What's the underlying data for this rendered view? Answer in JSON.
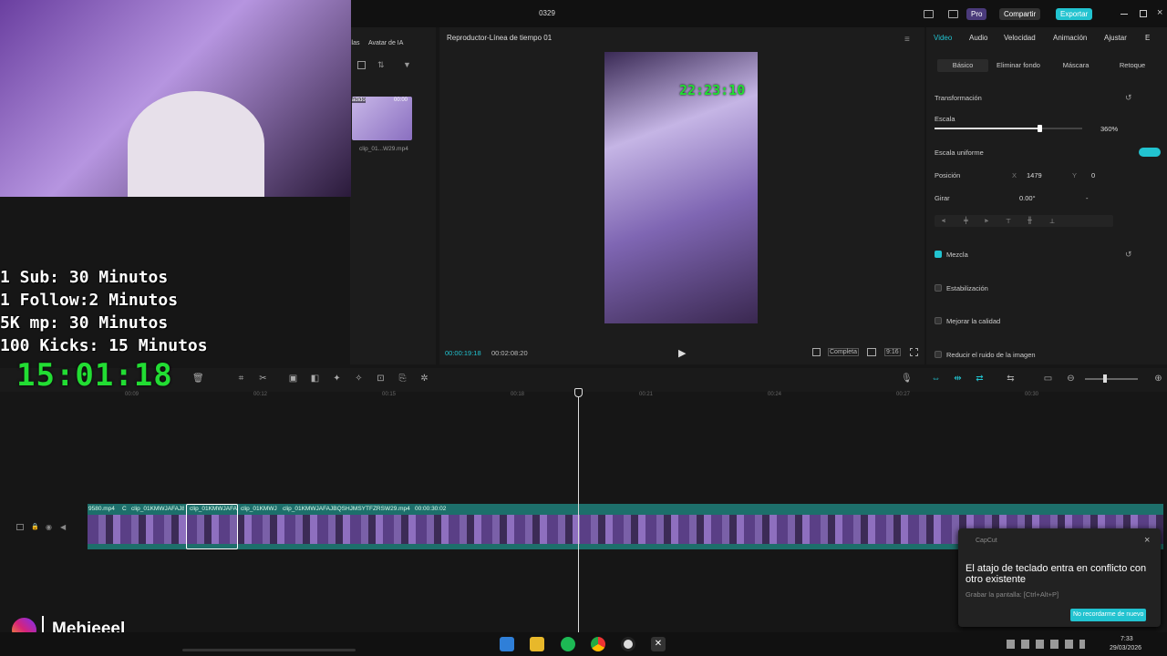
{
  "window": {
    "project_name": "0329",
    "pro_label": "Pro",
    "share_label": "Compartir",
    "export_label": "Exportar"
  },
  "media": {
    "tab_templates": "llas",
    "tab_ai_avatar": "Avatar de IA",
    "thumb_badge_left": "adido",
    "thumb_duration": "00:00",
    "thumb_name": "clip_01...W29.mp4"
  },
  "player": {
    "title": "Reproductor-Línea de tiempo 01",
    "preview_clock": "22:23:10",
    "current_time": "00:00:19:18",
    "total_time": "00:02:08:20",
    "quality_label": "Completa",
    "ratio_label": "9:16"
  },
  "props": {
    "tabs": [
      "Video",
      "Audio",
      "Velocidad",
      "Animación",
      "Ajustar",
      "E"
    ],
    "subtabs": [
      "Básico",
      "Eliminar fondo",
      "Máscara",
      "Retoque"
    ],
    "transform_label": "Transformación",
    "scale_label": "Escala",
    "scale_value": "360%",
    "uniform_scale_label": "Escala uniforme",
    "position_label": "Posición",
    "pos_x_label": "X",
    "pos_x": "1479",
    "pos_y_label": "Y",
    "pos_y": "0",
    "rotate_label": "Girar",
    "rotate_value": "0.00°",
    "rotate_extra": "-",
    "blend_label": "Mezcla",
    "stabilize_label": "Estabilización",
    "improve_label": "Mejorar la calidad",
    "denoise_label": "Reducir el ruido de la imagen",
    "accent_color": "#22c3d0"
  },
  "timeline": {
    "ruler": [
      "00:09",
      "00:12",
      "00:15",
      "00:18",
      "00:21",
      "00:24",
      "00:27",
      "00:30"
    ],
    "clip_labels": [
      "9580.mp4",
      "C",
      "clip_01KMWJAFAJ8",
      "clip_01KMWJAFA",
      "clip_01KMWJ",
      "clip_01KMWJAFAJBQSHJMSYTFZRSW29.mp4",
      "00:00:30:02"
    ]
  },
  "overlay": {
    "lines": [
      "1 Sub: 30 Minutos",
      "1 Follow:2 Minutos",
      "5K mp: 30 Minutos",
      "100 Kicks: 15 Minutos"
    ],
    "timer": "15:01:18",
    "handle": "Mehieeel"
  },
  "toast": {
    "app": "CapCut",
    "message": "El atajo de teclado entra en conflicto con otro existente",
    "detail": "Grabar la pantalla: [Ctrl+Alt+P]",
    "button": "No recordarme de nuevo"
  },
  "taskbar": {
    "time": "7:33",
    "date": "29/03/2026"
  }
}
